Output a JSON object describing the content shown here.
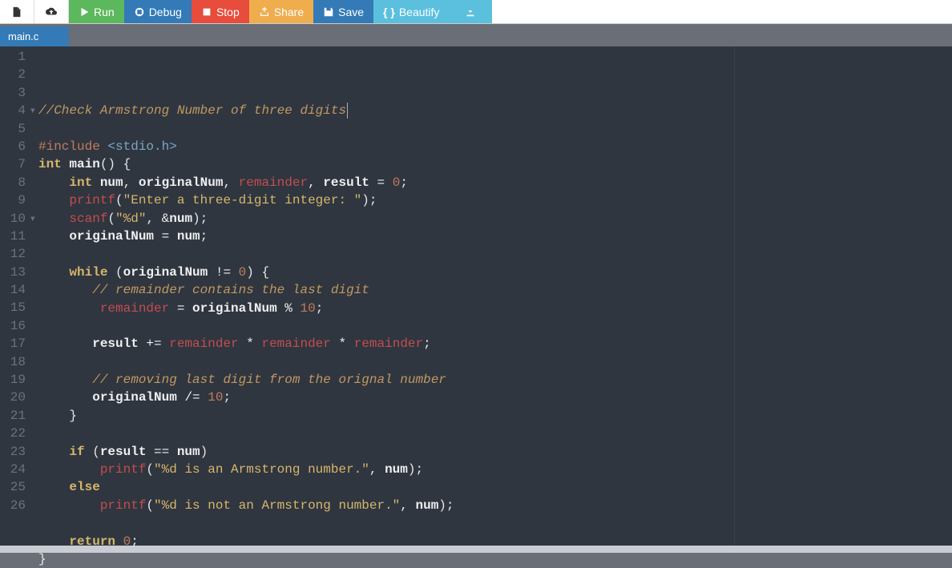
{
  "toolbar": {
    "new_file": "",
    "upload": "",
    "run": "Run",
    "debug": "Debug",
    "stop": "Stop",
    "share": "Share",
    "save": "Save",
    "beautify": "Beautify",
    "download": ""
  },
  "tabs": [
    {
      "label": "main.c",
      "active": true
    }
  ],
  "editor": {
    "line_numbers": [
      "1",
      "2",
      "3",
      "4",
      "5",
      "6",
      "7",
      "8",
      "9",
      "10",
      "11",
      "12",
      "13",
      "14",
      "15",
      "16",
      "17",
      "18",
      "19",
      "20",
      "21",
      "22",
      "23",
      "24",
      "25",
      "26"
    ],
    "fold_lines": [
      4,
      10
    ],
    "code_lines": [
      {
        "tokens": [
          {
            "t": "//Check Armstrong Number of three digits",
            "c": "cm"
          },
          {
            "t": "",
            "c": "cursor"
          }
        ]
      },
      {
        "tokens": []
      },
      {
        "tokens": [
          {
            "t": "#include ",
            "c": "pp"
          },
          {
            "t": "<stdio.h>",
            "c": "inc"
          }
        ]
      },
      {
        "tokens": [
          {
            "t": "int",
            "c": "kw"
          },
          {
            "t": " ",
            "c": "op"
          },
          {
            "t": "main",
            "c": "id"
          },
          {
            "t": "() {",
            "c": "pn"
          }
        ]
      },
      {
        "tokens": [
          {
            "t": "    ",
            "c": "op"
          },
          {
            "t": "int",
            "c": "kw"
          },
          {
            "t": " ",
            "c": "op"
          },
          {
            "t": "num",
            "c": "id"
          },
          {
            "t": ", ",
            "c": "pn"
          },
          {
            "t": "originalNum",
            "c": "id"
          },
          {
            "t": ", ",
            "c": "pn"
          },
          {
            "t": "remainder",
            "c": "rd"
          },
          {
            "t": ", ",
            "c": "pn"
          },
          {
            "t": "result",
            "c": "id"
          },
          {
            "t": " = ",
            "c": "op"
          },
          {
            "t": "0",
            "c": "nu"
          },
          {
            "t": ";",
            "c": "pn"
          }
        ]
      },
      {
        "tokens": [
          {
            "t": "    ",
            "c": "op"
          },
          {
            "t": "printf",
            "c": "rd"
          },
          {
            "t": "(",
            "c": "pn"
          },
          {
            "t": "\"Enter a three-digit integer: \"",
            "c": "st"
          },
          {
            "t": ");",
            "c": "pn"
          }
        ]
      },
      {
        "tokens": [
          {
            "t": "    ",
            "c": "op"
          },
          {
            "t": "scanf",
            "c": "rd"
          },
          {
            "t": "(",
            "c": "pn"
          },
          {
            "t": "\"%d\"",
            "c": "st"
          },
          {
            "t": ", &",
            "c": "pn"
          },
          {
            "t": "num",
            "c": "id"
          },
          {
            "t": ");",
            "c": "pn"
          }
        ]
      },
      {
        "tokens": [
          {
            "t": "    ",
            "c": "op"
          },
          {
            "t": "originalNum",
            "c": "id"
          },
          {
            "t": " = ",
            "c": "op"
          },
          {
            "t": "num",
            "c": "id"
          },
          {
            "t": ";",
            "c": "pn"
          }
        ]
      },
      {
        "tokens": []
      },
      {
        "tokens": [
          {
            "t": "    ",
            "c": "op"
          },
          {
            "t": "while",
            "c": "kw"
          },
          {
            "t": " (",
            "c": "pn"
          },
          {
            "t": "originalNum",
            "c": "id"
          },
          {
            "t": " != ",
            "c": "op"
          },
          {
            "t": "0",
            "c": "nu"
          },
          {
            "t": ") {",
            "c": "pn"
          }
        ]
      },
      {
        "tokens": [
          {
            "t": "       ",
            "c": "op"
          },
          {
            "t": "// remainder contains the last digit",
            "c": "cm"
          }
        ]
      },
      {
        "tokens": [
          {
            "t": "        ",
            "c": "op"
          },
          {
            "t": "remainder",
            "c": "rd"
          },
          {
            "t": " = ",
            "c": "op"
          },
          {
            "t": "originalNum",
            "c": "id"
          },
          {
            "t": " % ",
            "c": "op"
          },
          {
            "t": "10",
            "c": "nu"
          },
          {
            "t": ";",
            "c": "pn"
          }
        ]
      },
      {
        "tokens": []
      },
      {
        "tokens": [
          {
            "t": "       ",
            "c": "op"
          },
          {
            "t": "result",
            "c": "id"
          },
          {
            "t": " += ",
            "c": "op"
          },
          {
            "t": "remainder",
            "c": "rd"
          },
          {
            "t": " * ",
            "c": "op"
          },
          {
            "t": "remainder",
            "c": "rd"
          },
          {
            "t": " * ",
            "c": "op"
          },
          {
            "t": "remainder",
            "c": "rd"
          },
          {
            "t": ";",
            "c": "pn"
          }
        ]
      },
      {
        "tokens": []
      },
      {
        "tokens": [
          {
            "t": "       ",
            "c": "op"
          },
          {
            "t": "// removing last digit from the orignal number",
            "c": "cm"
          }
        ]
      },
      {
        "tokens": [
          {
            "t": "       ",
            "c": "op"
          },
          {
            "t": "originalNum",
            "c": "id"
          },
          {
            "t": " /= ",
            "c": "op"
          },
          {
            "t": "10",
            "c": "nu"
          },
          {
            "t": ";",
            "c": "pn"
          }
        ]
      },
      {
        "tokens": [
          {
            "t": "    }",
            "c": "pn"
          }
        ]
      },
      {
        "tokens": []
      },
      {
        "tokens": [
          {
            "t": "    ",
            "c": "op"
          },
          {
            "t": "if",
            "c": "kw"
          },
          {
            "t": " (",
            "c": "pn"
          },
          {
            "t": "result",
            "c": "id"
          },
          {
            "t": " == ",
            "c": "op"
          },
          {
            "t": "num",
            "c": "id"
          },
          {
            "t": ")",
            "c": "pn"
          }
        ]
      },
      {
        "tokens": [
          {
            "t": "        ",
            "c": "op"
          },
          {
            "t": "printf",
            "c": "rd"
          },
          {
            "t": "(",
            "c": "pn"
          },
          {
            "t": "\"%d is an Armstrong number.\"",
            "c": "st"
          },
          {
            "t": ", ",
            "c": "pn"
          },
          {
            "t": "num",
            "c": "id"
          },
          {
            "t": ");",
            "c": "pn"
          }
        ]
      },
      {
        "tokens": [
          {
            "t": "    ",
            "c": "op"
          },
          {
            "t": "else",
            "c": "kw"
          }
        ]
      },
      {
        "tokens": [
          {
            "t": "        ",
            "c": "op"
          },
          {
            "t": "printf",
            "c": "rd"
          },
          {
            "t": "(",
            "c": "pn"
          },
          {
            "t": "\"%d is not an Armstrong number.\"",
            "c": "st"
          },
          {
            "t": ", ",
            "c": "pn"
          },
          {
            "t": "num",
            "c": "id"
          },
          {
            "t": ");",
            "c": "pn"
          }
        ]
      },
      {
        "tokens": []
      },
      {
        "tokens": [
          {
            "t": "    ",
            "c": "op"
          },
          {
            "t": "return",
            "c": "kw"
          },
          {
            "t": " ",
            "c": "op"
          },
          {
            "t": "0",
            "c": "nu"
          },
          {
            "t": ";",
            "c": "pn"
          }
        ]
      },
      {
        "tokens": [
          {
            "t": "}",
            "c": "pn"
          }
        ]
      }
    ]
  }
}
